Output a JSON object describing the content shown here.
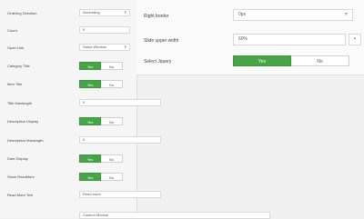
{
  "left_form": {
    "ordering_direction": {
      "label": "Ordering Direction",
      "value": "Ascending"
    },
    "count": {
      "label": "Count",
      "value": "5"
    },
    "open_link": {
      "label": "Open Link",
      "value": "Same Window"
    },
    "category_title": {
      "label": "Category Title",
      "yes": "Yes",
      "no": "No"
    },
    "item_title": {
      "label": "Item Title",
      "yes": "Yes",
      "no": "No"
    },
    "title_maxlength": {
      "label": "Title Maxlength",
      "value": "0"
    },
    "description_display": {
      "label": "Description Display",
      "yes": "Yes",
      "no": "No"
    },
    "description_maxlength": {
      "label": "Description Maxlength",
      "value": "0"
    },
    "date_display": {
      "label": "Date Display",
      "yes": "Yes",
      "no": "No"
    },
    "show_readmore": {
      "label": "Show ReadMore",
      "yes": "Yes",
      "no": "No"
    },
    "readmore_text": {
      "label": "Read More Text",
      "value": "Read more"
    },
    "bottom_value": "Custom Module"
  },
  "right_form": {
    "right_border": {
      "label": "Right border",
      "value": "0px"
    },
    "slide_upper_width": {
      "label": "Slide upper width",
      "value": "60%"
    },
    "select_jquery": {
      "label": "Select Jquery",
      "yes": "Yes",
      "no": "No"
    }
  },
  "icons": {
    "dropdown": "chevron-down-icon",
    "add": "plus-icon"
  },
  "colors": {
    "toggle_on": "#46a546",
    "background": "#f0f0f0"
  }
}
